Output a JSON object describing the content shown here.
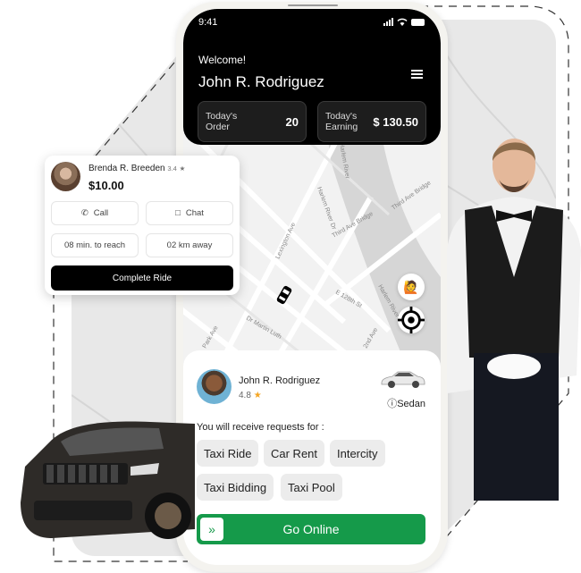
{
  "status_bar": {
    "time": "9:41"
  },
  "header": {
    "welcome": "Welcome!",
    "driver_name": "John R. Rodriguez",
    "stats": [
      {
        "label": "Today's Order",
        "value": "20"
      },
      {
        "label": "Today's Earning",
        "value": "$ 130.50"
      }
    ]
  },
  "map": {
    "labels": [
      "Harlem River",
      "Harlem River Dr",
      "Third Ave Bridge",
      "Third Ave Bridge",
      "Lexington Ave",
      "E 128th St",
      "Harlem River Dr",
      "Park Ave",
      "Dr Martin Luth",
      "2nd Ave"
    ],
    "buttons": [
      "hail-passenger",
      "recenter-location"
    ]
  },
  "ride_card": {
    "rider_name": "Brenda R. Breeden",
    "rider_rating": "3.4",
    "fare": "$10.00",
    "call_label": "Call",
    "chat_label": "Chat",
    "eta": "08 min. to reach",
    "distance": "02 km away",
    "complete_label": "Complete Ride"
  },
  "sheet": {
    "driver_name": "John R. Rodriguez",
    "rating": "4.8",
    "vehicle_type": "Sedan",
    "requests_label": "You will receive requests for :",
    "services": [
      "Taxi Ride",
      "Car Rent",
      "Intercity",
      "Taxi Bidding",
      "Taxi Pool"
    ],
    "go_online_label": "Go Online"
  },
  "colors": {
    "accent_green": "#159a4a",
    "header_black": "#000000",
    "star": "#f5a623"
  }
}
